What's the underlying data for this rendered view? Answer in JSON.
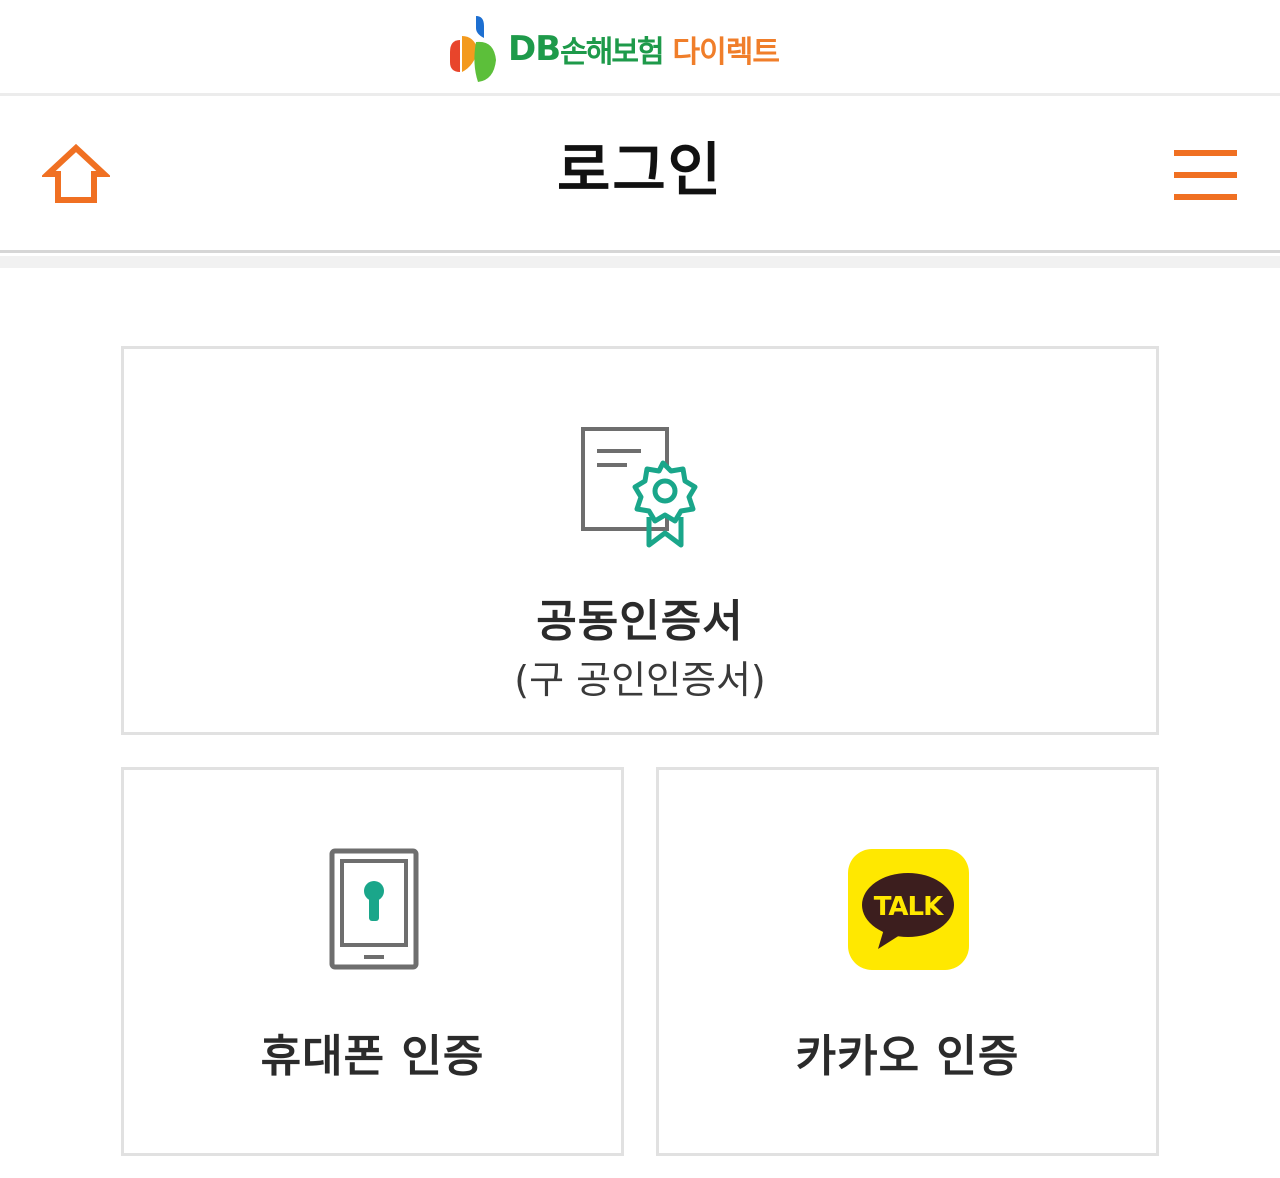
{
  "brand": {
    "db": "DB",
    "company": "손해보험",
    "direct": "다이렉트"
  },
  "nav": {
    "title": "로그인",
    "home_icon": "home-icon",
    "menu_icon": "hamburger-menu-icon"
  },
  "login_options": {
    "certificate": {
      "title": "공동인증서",
      "subtitle": "(구 공인인증서)",
      "icon": "certificate-icon"
    },
    "phone": {
      "title": "휴대폰 인증",
      "icon": "phone-lock-icon"
    },
    "kakao": {
      "title": "카카오 인증",
      "icon_text": "TALK",
      "icon": "kakao-talk-icon"
    }
  },
  "colors": {
    "accent_orange": "#f07022",
    "brand_green": "#1e9a4a",
    "icon_teal": "#1aa68a",
    "kakao_yellow": "#ffe800",
    "kakao_brown": "#3c1e1e"
  }
}
